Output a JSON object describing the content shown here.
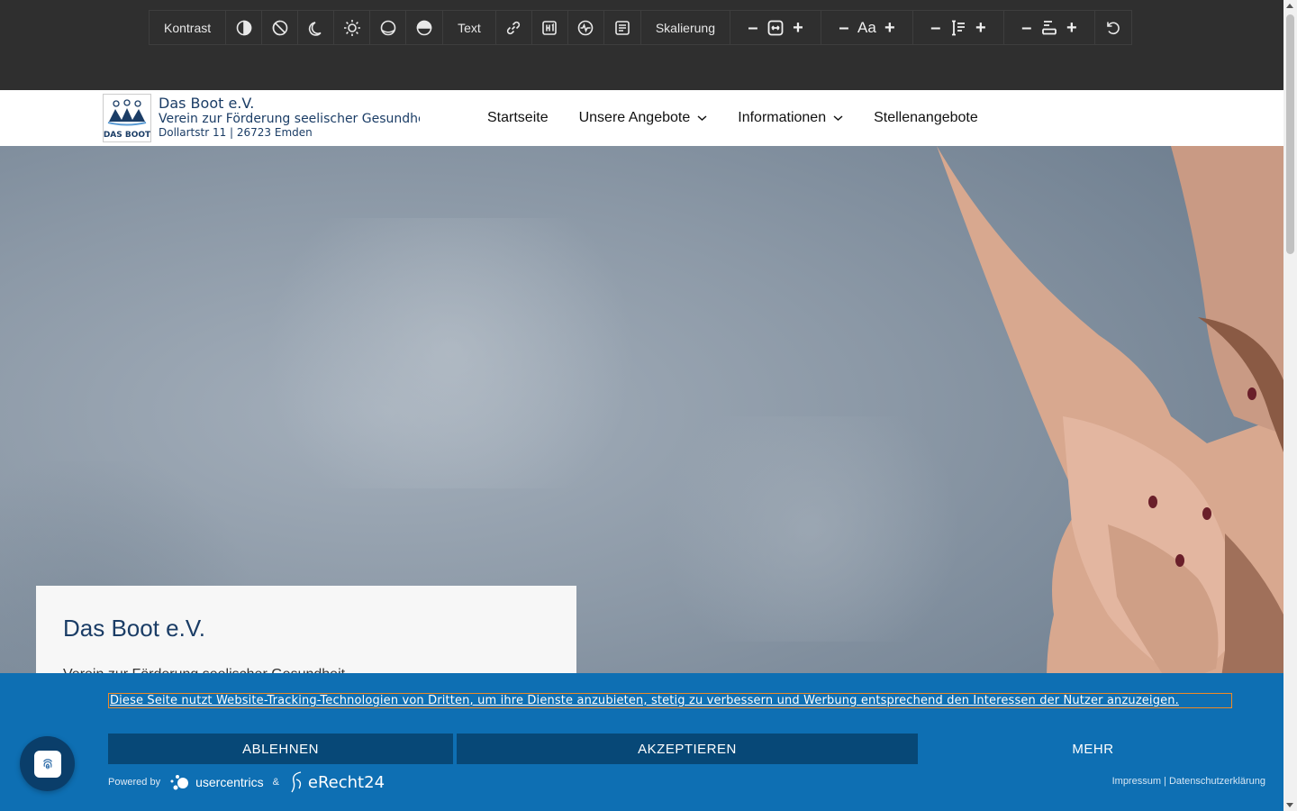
{
  "toolbar": {
    "contrast_label": "Kontrast",
    "contrast_icons": [
      "half-circle-icon",
      "no-color-icon",
      "moon-icon",
      "sun-icon",
      "low-saturation-icon",
      "high-saturation-icon"
    ],
    "text_label": "Text",
    "text_icons": [
      "link-icon",
      "heading-icon",
      "readable-font-icon",
      "paragraph-icon"
    ],
    "scale_label": "Skalierung",
    "font_size_label": "Aa",
    "minus": "–",
    "plus": "+"
  },
  "header": {
    "brand_name": "Das Boot e.V.",
    "brand_tagline": "Verein zur Förderung seelischer Gesundheit",
    "brand_address": "Dollartstr 11 | 26723 Emden",
    "logo_text": "DAS BOOT",
    "nav": [
      {
        "label": "Startseite",
        "dropdown": false
      },
      {
        "label": "Unsere Angebote",
        "dropdown": true
      },
      {
        "label": "Informationen",
        "dropdown": true
      },
      {
        "label": "Stellenangebote",
        "dropdown": false
      }
    ]
  },
  "hero": {
    "title": "Das Boot e.V.",
    "subtitle": "Verein zur Förderung seelischer Gesundheit"
  },
  "cookie": {
    "message": "Diese Seite nutzt Website-Tracking-Technologien von Dritten, um ihre Dienste anzubieten, stetig zu verbessern und Werbung entsprechend den Interessen der Nutzer anzuzeigen.",
    "decline": "ABLEHNEN",
    "accept": "AKZEPTIEREN",
    "more": "MEHR",
    "powered_by": "Powered by",
    "usercentrics": "usercentrics",
    "ampersand": "&",
    "erecht": "eRecht24",
    "imprint": "Impressum",
    "separator": "|",
    "privacy": "Datenschutzerklärung",
    "colors": {
      "banner": "#0e6fb3",
      "button": "#074877",
      "focus": "#f08a24"
    }
  }
}
